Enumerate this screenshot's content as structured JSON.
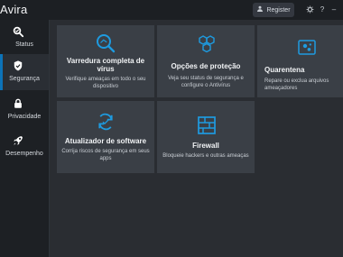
{
  "app": {
    "name": "Avira",
    "register_label": "Register",
    "top_icons": [
      "gear-icon",
      "help-icon",
      "minimize-icon"
    ]
  },
  "sidebar": {
    "items": [
      {
        "label": "Status",
        "icon": "status-icon"
      },
      {
        "label": "Segurança",
        "icon": "shield-icon"
      },
      {
        "label": "Privacidade",
        "icon": "lock-icon"
      },
      {
        "label": "Desempenho",
        "icon": "rocket-icon"
      }
    ]
  },
  "cards": [
    {
      "title": "Varredura completa de vírus",
      "description": "Verifique ameaças em todo o seu dispositivo",
      "icon": "search-icon"
    },
    {
      "title": "Opções de proteção",
      "description": "Veja seu status de segurança e configure o Antivírus",
      "icon": "hexagon-icon"
    },
    {
      "title": "Quarentena",
      "description": "Repare ou exclua arquivos ameaçadores",
      "icon": "quarantine-icon"
    },
    {
      "title": "Atualizador de software",
      "description": "Corrija riscos de segurança em seus apps",
      "icon": "refresh-icon"
    },
    {
      "title": "Firewall",
      "description": "Bloqueie hackers e outras ameaças",
      "icon": "firewall-icon"
    }
  ],
  "colors": {
    "accent": "#1e9be0",
    "active_nav": "#0c73b8",
    "card_bg": "#3a3f46"
  }
}
